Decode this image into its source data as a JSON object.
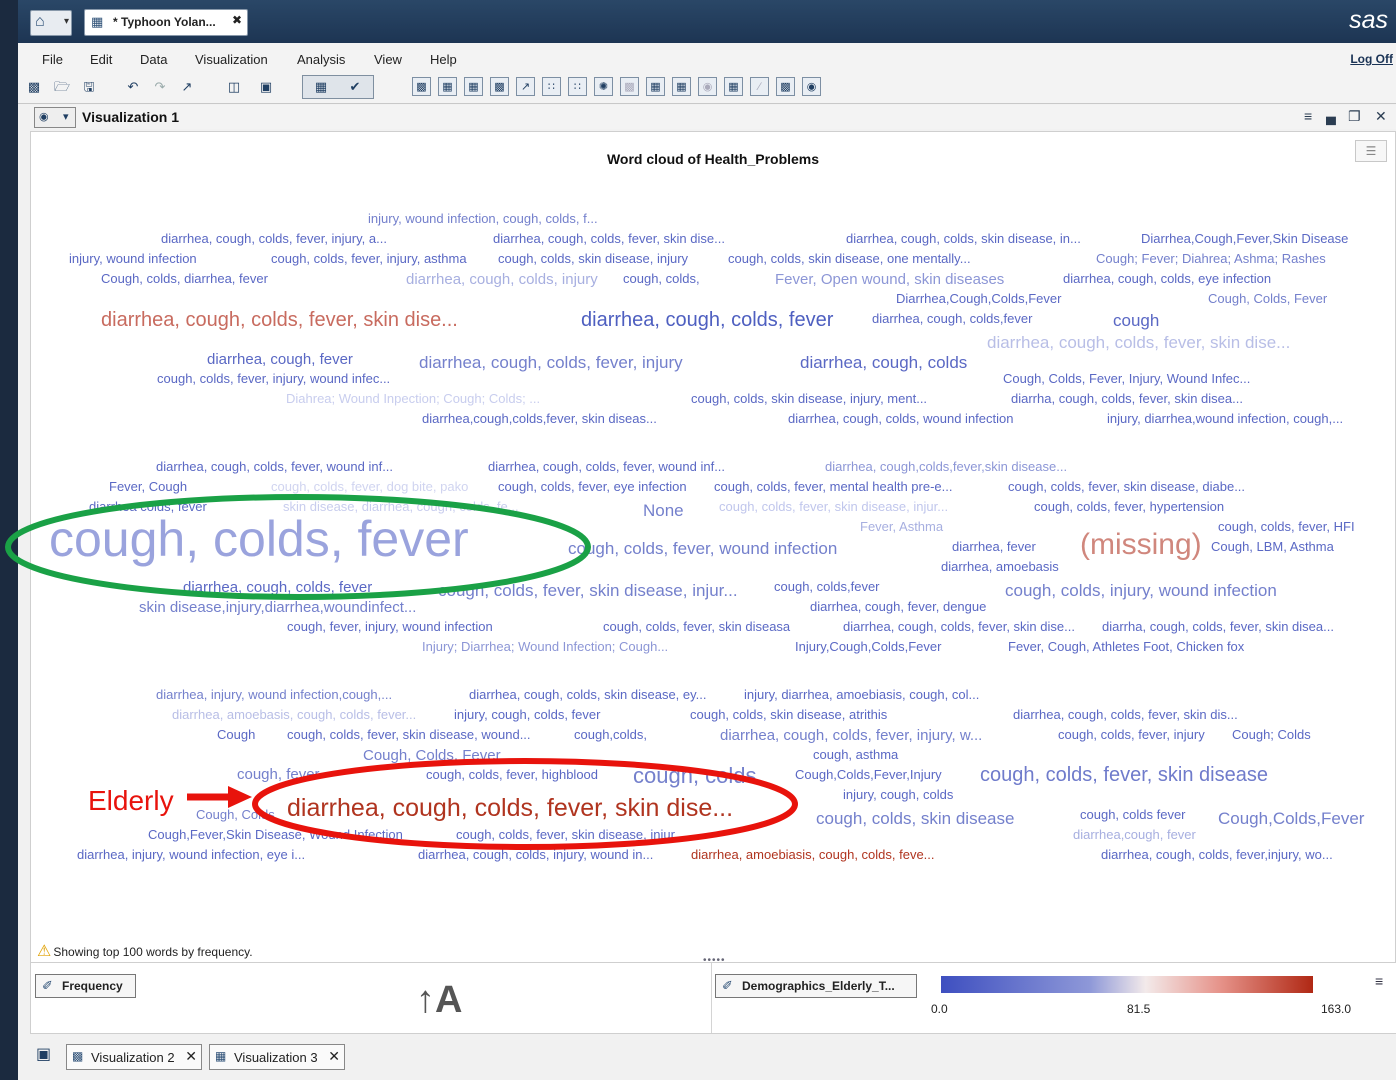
{
  "window": {
    "tab_title": "* Typhoon Yolan...",
    "brand": "sas"
  },
  "menu": [
    "File",
    "Edit",
    "Data",
    "Visualization",
    "Analysis",
    "View",
    "Help"
  ],
  "logoff_label": "Log Off",
  "viz": {
    "title": "Visualization 1"
  },
  "chart_data": {
    "type": "wordcloud",
    "title": "Word cloud of Health_Problems",
    "words": [
      {
        "text": "injury, wound infection, cough, colds, f...",
        "c": "#7480cc"
      },
      {
        "text": "diarrhea, cough, colds, fever, injury, a...",
        "c": "#5a68c4"
      },
      {
        "text": "diarrhea, cough, colds, fever, skin dise...",
        "c": "#5a68c4"
      },
      {
        "text": "diarrhea, cough, colds, skin disease, in...",
        "c": "#5a68c4"
      },
      {
        "text": "Diarrhea,Cough,Fever,Skin Disease",
        "c": "#5a68c4"
      },
      {
        "text": "injury, wound infection",
        "c": "#5a68c4"
      },
      {
        "text": "cough, colds, fever, injury, asthma",
        "c": "#5a68c4"
      },
      {
        "text": "cough, colds, skin disease, injury",
        "c": "#5a68c4"
      },
      {
        "text": "cough, colds, skin disease, one mentally...",
        "c": "#5a68c4"
      },
      {
        "text": "Cough; Fever; Diahrea; Ashma; Rashes",
        "c": "#7480cc"
      },
      {
        "text": "Cough, colds, diarrhea, fever",
        "c": "#5a68c4"
      },
      {
        "text": "diarrhea, cough, colds, injury",
        "c": "#a7afe0"
      },
      {
        "text": "cough, colds,",
        "c": "#5a68c4"
      },
      {
        "text": "Fever, Open wound, skin diseases",
        "c": "#8c96d6"
      },
      {
        "text": "diarrhea, cough, colds, eye infection",
        "c": "#5a68c4"
      },
      {
        "text": "Diarrhea,Cough,Colds,Fever",
        "c": "#5a68c4"
      },
      {
        "text": "Cough, Colds, Fever",
        "c": "#7480cc"
      },
      {
        "text": "diarrhea, cough, colds, fever, skin dise...",
        "c": "#c86b5f"
      },
      {
        "text": "diarrhea, cough, colds, fever",
        "c": "#4e5fc0"
      },
      {
        "text": "diarrhea, cough, colds,fever",
        "c": "#5a68c4"
      },
      {
        "text": "cough",
        "c": "#5a68c4"
      },
      {
        "text": "diarrhea, cough, colds, fever, skin dise...",
        "c": "#b8bee6"
      },
      {
        "text": "diarrhea, cough, fever",
        "c": "#5a68c4"
      },
      {
        "text": "diarrhea, cough, colds, fever, injury",
        "c": "#7480cc"
      },
      {
        "text": "diarrhea, cough, colds",
        "c": "#5a68c4"
      },
      {
        "text": "cough, colds, fever, injury, wound infec...",
        "c": "#5a68c4"
      },
      {
        "text": "Cough, Colds, Fever, Injury, Wound Infec...",
        "c": "#5a68c4"
      },
      {
        "text": "Diahrea; Wound Inpection; Cough; Colds; ...",
        "c": "#c8cdee"
      },
      {
        "text": "cough, colds, skin disease, injury, ment...",
        "c": "#5a68c4"
      },
      {
        "text": "diarrha, cough, colds, fever, skin disea...",
        "c": "#5a68c4"
      },
      {
        "text": "diarrhea,cough,colds,fever, skin diseas...",
        "c": "#5a68c4"
      },
      {
        "text": "diarrhea, cough, colds, wound infection",
        "c": "#5a68c4"
      },
      {
        "text": "injury, diarrhea,wound infection, cough,...",
        "c": "#5a68c4"
      },
      {
        "text": "diarrhea, cough, colds, fever, wound inf...",
        "c": "#5a68c4"
      },
      {
        "text": "diarrhea, cough, colds, fever, wound inf...",
        "c": "#5a68c4"
      },
      {
        "text": "diarrhea, cough,colds,fever,skin disease...",
        "c": "#8c96d6"
      },
      {
        "text": "Fever, Cough",
        "c": "#5a68c4"
      },
      {
        "text": "cough, colds, fever, dog bite, pako",
        "c": "#d0d4f0"
      },
      {
        "text": "cough, colds, fever, eye infection",
        "c": "#5a68c4"
      },
      {
        "text": "cough, colds, fever, mental health pre-e...",
        "c": "#5a68c4"
      },
      {
        "text": "cough, colds, fever, skin disease, diabe...",
        "c": "#5a68c4"
      },
      {
        "text": "diarrhea colds, fever",
        "c": "#5a68c4"
      },
      {
        "text": "skin disease, diarrhea, cough, colds, fe...",
        "c": "#c8cdee"
      },
      {
        "text": "None",
        "c": "#7480cc"
      },
      {
        "text": "cough, colds, fever, skin disease, injur...",
        "c": "#c0c6ec"
      },
      {
        "text": "cough, colds, fever, hypertension",
        "c": "#5a68c4"
      },
      {
        "text": "Fever, Asthma",
        "c": "#a7afe0"
      },
      {
        "text": "cough, colds, fever, HFI",
        "c": "#5a68c4"
      },
      {
        "text": "cough, colds, fever",
        "c": "#9aa3dd"
      },
      {
        "text": "cough, colds, fever, wound infection",
        "c": "#7480cc"
      },
      {
        "text": "diarrhea, fever",
        "c": "#5a68c4"
      },
      {
        "text": "(missing)",
        "c": "#d0877d"
      },
      {
        "text": "Cough, LBM, Asthma",
        "c": "#5a68c4"
      },
      {
        "text": "diarrhea, amoebasis",
        "c": "#5a68c4"
      },
      {
        "text": "diarrhea, cough, colds, fever",
        "c": "#5a68c4"
      },
      {
        "text": "cough, colds, fever, skin disease, injur...",
        "c": "#7480cc"
      },
      {
        "text": "cough, colds,fever",
        "c": "#5a68c4"
      },
      {
        "text": "cough, colds, injury, wound infection",
        "c": "#7480cc"
      },
      {
        "text": "skin disease,injury,diarrhea,woundinfect...",
        "c": "#7480cc"
      },
      {
        "text": "diarrhea, cough, fever, dengue",
        "c": "#5a68c4"
      },
      {
        "text": "cough, fever, injury, wound infection",
        "c": "#5a68c4"
      },
      {
        "text": "cough, colds, fever, skin diseasa",
        "c": "#5a68c4"
      },
      {
        "text": "diarrhea, cough, colds, fever, skin dise...",
        "c": "#5a68c4"
      },
      {
        "text": "diarrha, cough, colds, fever, skin disea...",
        "c": "#5a68c4"
      },
      {
        "text": "Injury; Diarrhea; Wound Infection; Cough...",
        "c": "#8c96d6"
      },
      {
        "text": "Injury,Cough,Colds,Fever",
        "c": "#5a68c4"
      },
      {
        "text": "Fever, Cough, Athletes Foot, Chicken fox",
        "c": "#5a68c4"
      },
      {
        "text": "diarrhea, injury, wound infection,cough,...",
        "c": "#7480cc"
      },
      {
        "text": "diarrhea, cough, colds, skin disease, ey...",
        "c": "#5a68c4"
      },
      {
        "text": "injury, diarrhea, amoebiasis, cough, col...",
        "c": "#5a68c4"
      },
      {
        "text": "diarrhea, amoebasis, cough, colds, fever...",
        "c": "#b8bee6"
      },
      {
        "text": "injury, cough, colds, fever",
        "c": "#5a68c4"
      },
      {
        "text": "cough, colds, skin disease, atrithis",
        "c": "#5a68c4"
      },
      {
        "text": "diarrhea, cough, colds,  fever, skin dis...",
        "c": "#5a68c4"
      },
      {
        "text": "Cough",
        "c": "#5a68c4"
      },
      {
        "text": "cough, colds, fever, skin disease, wound...",
        "c": "#5a68c4"
      },
      {
        "text": "cough,colds,",
        "c": "#5a68c4"
      },
      {
        "text": "diarrhea, cough, colds, fever, injury, w...",
        "c": "#7480cc"
      },
      {
        "text": "cough, colds, fever, injury",
        "c": "#5a68c4"
      },
      {
        "text": "Cough; Colds",
        "c": "#5a68c4"
      },
      {
        "text": "Cough, Colds, Fever",
        "c": "#7480cc"
      },
      {
        "text": "cough, asthma",
        "c": "#5a68c4"
      },
      {
        "text": "cough, fever",
        "c": "#7480cc"
      },
      {
        "text": "cough, colds, fever, highblood",
        "c": "#5a68c4"
      },
      {
        "text": "cough, colds",
        "c": "#7480cc"
      },
      {
        "text": "Cough,Colds,Fever,Injury",
        "c": "#5a68c4"
      },
      {
        "text": "cough, colds, fever, skin disease",
        "c": "#6f7bcb"
      },
      {
        "text": "injury, cough, colds",
        "c": "#5a68c4"
      },
      {
        "text": "diarrhea, cough, colds, fever, skin dise...",
        "c": "#b0341f"
      },
      {
        "text": "Cough, Colds",
        "c": "#7480cc"
      },
      {
        "text": "cough, colds, skin disease",
        "c": "#7480cc"
      },
      {
        "text": "cough, colds fever",
        "c": "#5a68c4"
      },
      {
        "text": "Cough,Colds,Fever",
        "c": "#7480cc"
      },
      {
        "text": "Cough,Fever,Skin Disease, Wound Infection",
        "c": "#5a68c4"
      },
      {
        "text": "cough, colds, fever, skin disease, injur...",
        "c": "#5a68c4"
      },
      {
        "text": "diarrhea,cough, fever",
        "c": "#a7afe0"
      },
      {
        "text": "diarrhea, injury, wound infection, eye i...",
        "c": "#5a68c4"
      },
      {
        "text": "diarrhea, cough, colds, injury, wound in...",
        "c": "#5a68c4"
      },
      {
        "text": "diarrhea, amoebiasis, cough, colds, feve...",
        "c": "#b0341f"
      },
      {
        "text": "diarrhea, cough, colds, fever,injury, wo...",
        "c": "#5a68c4"
      }
    ]
  },
  "footer_note": "Showing top 100 words by frequency.",
  "legend": {
    "size_chip": "Frequency",
    "color_chip": "Demographics_Elderly_T...",
    "min": "0.0",
    "mid": "81.5",
    "max": "163.0"
  },
  "annotation": {
    "label": "Elderly",
    "green_color": "#1aa146",
    "red_color": "#e8130c"
  },
  "bottom_tabs": [
    "Visualization 2",
    "Visualization 3"
  ]
}
